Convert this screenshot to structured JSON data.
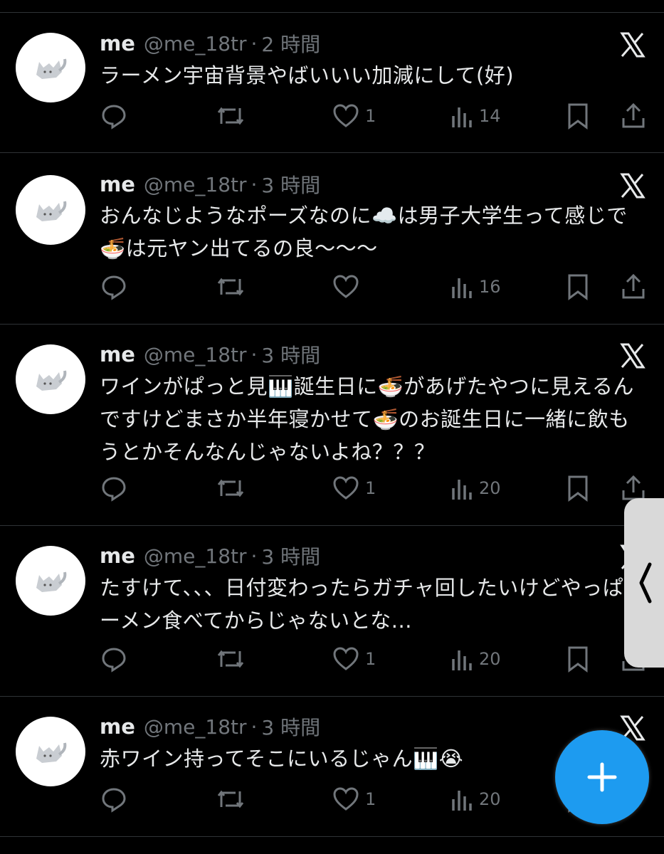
{
  "tweets": [
    {
      "name": "me",
      "handle": "@me_18tr",
      "sep": "·",
      "time": "2 時間",
      "text": "ラーメン宇宙背景やばいいい加減にして(好)",
      "likes": "1",
      "views": "14"
    },
    {
      "name": "me",
      "handle": "@me_18tr",
      "sep": "·",
      "time": "3 時間",
      "text": "おんなじようなポーズなのに☁️は男子大学生って感じで🍜は元ヤン出てるの良〜〜〜",
      "likes": "",
      "views": "16"
    },
    {
      "name": "me",
      "handle": "@me_18tr",
      "sep": "·",
      "time": "3 時間",
      "text": "ワインがぱっと見🎹誕生日に🍜があげたやつに見えるんですけどまさか半年寝かせて🍜のお誕生日に一緒に飲もうとかそんなんじゃないよね？？？",
      "likes": "1",
      "views": "20"
    },
    {
      "name": "me",
      "handle": "@me_18tr",
      "sep": "·",
      "time": "3 時間",
      "text": "たすけて、、、日付変わったらガチャ回したいけどやっぱラーメン食べてからじゃないとな...",
      "likes": "1",
      "views": "20"
    },
    {
      "name": "me",
      "handle": "@me_18tr",
      "sep": "·",
      "time": "3 時間",
      "text": "赤ワイン持ってそこにいるじゃん🎹😭",
      "likes": "1",
      "views": "20"
    }
  ],
  "compose": {
    "icon": "plus-icon"
  },
  "side_handle": {
    "icon": "chevron-left-icon"
  },
  "colors": {
    "background": "#000000",
    "text": "#e7e9ea",
    "muted": "#71767b",
    "accent": "#1d9bf0"
  }
}
